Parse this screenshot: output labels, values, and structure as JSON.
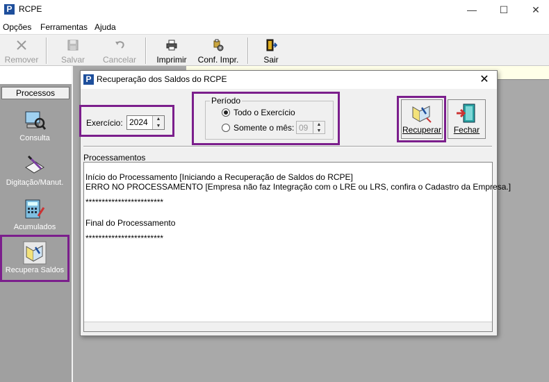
{
  "window": {
    "title": "RCPE",
    "icon_letter": "P",
    "controls": {
      "minimize": "—",
      "maximize": "☐",
      "close": "✕"
    }
  },
  "menu": [
    "Opções",
    "Ferramentas",
    "Ajuda"
  ],
  "toolbar": {
    "remover": "Remover",
    "salvar": "Salvar",
    "cancelar": "Cancelar",
    "imprimir": "Imprimir",
    "conf_impr": "Conf. Impr.",
    "sair": "Sair"
  },
  "left_panel": {
    "header": "Processos",
    "items": [
      {
        "label": "Consulta",
        "icon": "consulta-icon"
      },
      {
        "label": "Digitação/Manut.",
        "icon": "digitacao-icon"
      },
      {
        "label": "Acumulados",
        "icon": "calculator-icon"
      },
      {
        "label": "Recupera Saldos",
        "icon": "recupera-saldos-icon",
        "selected": true
      }
    ]
  },
  "dialog": {
    "title": "Recuperação dos Saldos do RCPE",
    "icon_letter": "P",
    "close": "✕",
    "exercicio_label": "Exercício:",
    "exercicio_value": "2024",
    "periodo_title": "Período",
    "radio_todo": "Todo o Exercício",
    "radio_mes": "Somente o mês:",
    "mes_value": "09",
    "selected_period": "Todo o Exercício",
    "btn_recuperar": "Recuperar",
    "btn_fechar": "Fechar",
    "processamentos_label": "Processamentos",
    "log": [
      "Início do Processamento [Iniciando a Recuperação de Saldos do RCPE]",
      "ERRO NO PROCESSAMENTO [Empresa não faz Integração com o LRE ou LRS, confira o Cadastro da Empresa.]",
      "",
      "************************",
      "",
      "Final do Processamento",
      "",
      "************************"
    ]
  },
  "colors": {
    "highlight": "#7b1e8c",
    "mdi_background": "#a9a9a9",
    "left_panel": "#a0a0a0",
    "app_icon": "#1e4f9c"
  }
}
